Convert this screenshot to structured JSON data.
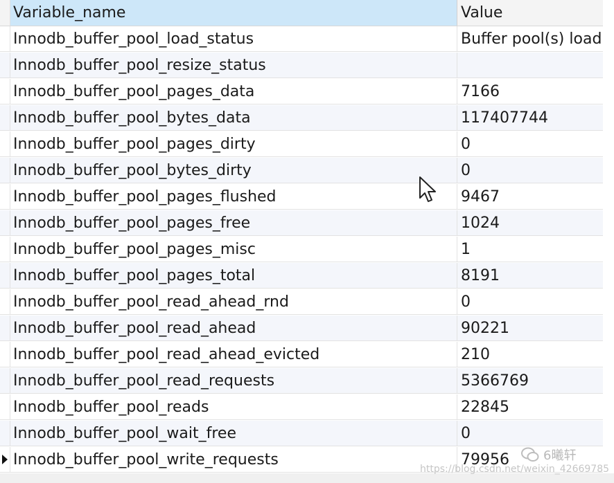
{
  "table": {
    "columns": {
      "name": "Variable_name",
      "value": "Value"
    },
    "rows": [
      {
        "name": "Innodb_buffer_pool_load_status",
        "value": "Buffer pool(s) load"
      },
      {
        "name": "Innodb_buffer_pool_resize_status",
        "value": ""
      },
      {
        "name": "Innodb_buffer_pool_pages_data",
        "value": "7166"
      },
      {
        "name": "Innodb_buffer_pool_bytes_data",
        "value": "117407744"
      },
      {
        "name": "Innodb_buffer_pool_pages_dirty",
        "value": "0"
      },
      {
        "name": "Innodb_buffer_pool_bytes_dirty",
        "value": "0"
      },
      {
        "name": "Innodb_buffer_pool_pages_flushed",
        "value": "9467"
      },
      {
        "name": "Innodb_buffer_pool_pages_free",
        "value": "1024"
      },
      {
        "name": "Innodb_buffer_pool_pages_misc",
        "value": "1"
      },
      {
        "name": "Innodb_buffer_pool_pages_total",
        "value": "8191"
      },
      {
        "name": "Innodb_buffer_pool_read_ahead_rnd",
        "value": "0"
      },
      {
        "name": "Innodb_buffer_pool_read_ahead",
        "value": "90221"
      },
      {
        "name": "Innodb_buffer_pool_read_ahead_evicted",
        "value": "210"
      },
      {
        "name": "Innodb_buffer_pool_read_requests",
        "value": "5366769"
      },
      {
        "name": "Innodb_buffer_pool_reads",
        "value": "22845"
      },
      {
        "name": "Innodb_buffer_pool_wait_free",
        "value": "0"
      },
      {
        "name": "Innodb_buffer_pool_write_requests",
        "value": "79956"
      }
    ],
    "current_row_index": 16
  },
  "watermark": {
    "label": "6曦轩",
    "url": "https://blog.csdn.net/weixin_42669785"
  },
  "icons": {
    "row_pointer": "current-row-pointer-icon",
    "cursor": "mouse-cursor-icon",
    "watermark": "wechat-icon"
  },
  "colors": {
    "header_selected": "#cde7f9",
    "row_alt": "#f4f6fb",
    "grid_line": "#e2e2e2"
  }
}
